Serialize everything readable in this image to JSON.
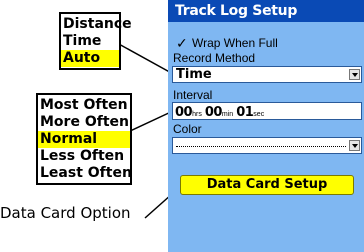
{
  "callouts": {
    "record_method_options": [
      {
        "label": "Distance",
        "selected": false
      },
      {
        "label": "Time",
        "selected": false
      },
      {
        "label": "Auto",
        "selected": true
      }
    ],
    "interval_options": [
      {
        "label": "Most Often",
        "selected": false
      },
      {
        "label": "More Often",
        "selected": false
      },
      {
        "label": "Normal",
        "selected": true
      },
      {
        "label": "Less Often",
        "selected": false
      },
      {
        "label": "Least Often",
        "selected": false
      }
    ],
    "caption": "Data Card Option"
  },
  "screen": {
    "title": "Track Log Setup",
    "wrap_when_full": {
      "label": "Wrap When Full",
      "checked": true,
      "check_glyph": "✓"
    },
    "record_method": {
      "label": "Record Method",
      "value": "Time"
    },
    "interval": {
      "label": "Interval",
      "hours": "00",
      "hours_unit": "hrs",
      "minutes": "00",
      "minutes_unit": "min",
      "seconds": "01",
      "seconds_unit": "sec"
    },
    "color": {
      "label": "Color",
      "value": ""
    },
    "data_card_button": "Data Card Setup"
  },
  "colors": {
    "title_bar": "#0a4ab5",
    "screen_background": "#7fb7f2",
    "highlight": "#ffff00",
    "callout_lines": "#000000"
  },
  "icons": [
    "checkmark-icon",
    "dropdown-arrow-icon"
  ]
}
